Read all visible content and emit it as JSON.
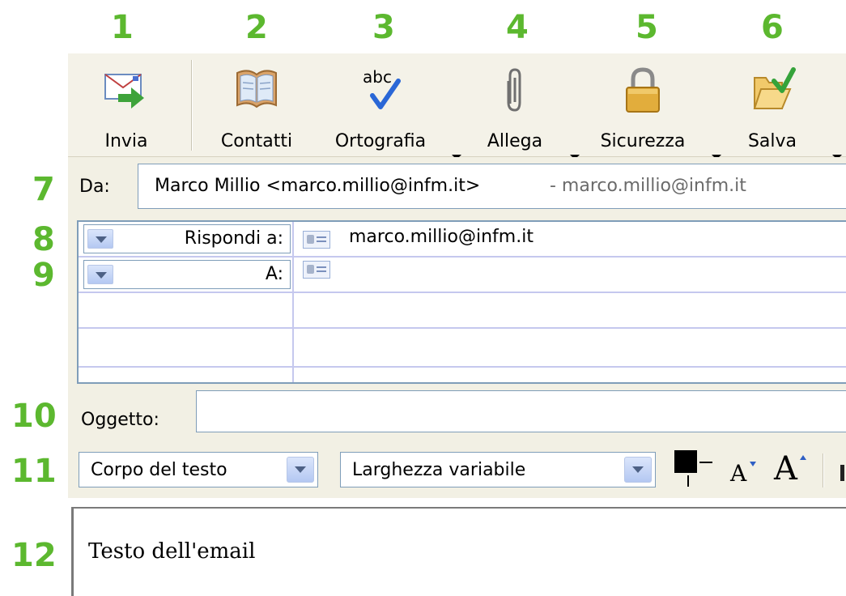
{
  "callouts": [
    "1",
    "2",
    "3",
    "4",
    "5",
    "6",
    "7",
    "8",
    "9",
    "10",
    "11",
    "12"
  ],
  "toolbar": {
    "send_label": "Invia",
    "contacts_label": "Contatti",
    "spelling_label": "Ortografia",
    "spelling_icon_text": "abc",
    "attach_label": "Allega",
    "security_label": "Sicurezza",
    "save_label": "Salva"
  },
  "header": {
    "from_label": "Da:",
    "from_value": "Marco Millio <marco.millio@infm.it>",
    "from_extra": "- marco.millio@infm.it",
    "recipients": [
      {
        "type": "Rispondi a:",
        "value": "marco.millio@infm.it"
      },
      {
        "type": "A:",
        "value": ""
      }
    ],
    "subject_label": "Oggetto:",
    "subject_value": ""
  },
  "format_bar": {
    "paragraph_style": "Corpo del testo",
    "font": "Larghezza variabile",
    "text_color": "#000000",
    "smaller_font_glyph": "A",
    "larger_font_glyph": "A"
  },
  "body": {
    "text": "Testo dell'email"
  },
  "colors": {
    "callout": "#5cb82f",
    "toolbar_bg": "#f4f2e8",
    "border_blue": "#7f9db9",
    "grid_line": "#c5c8ee"
  }
}
